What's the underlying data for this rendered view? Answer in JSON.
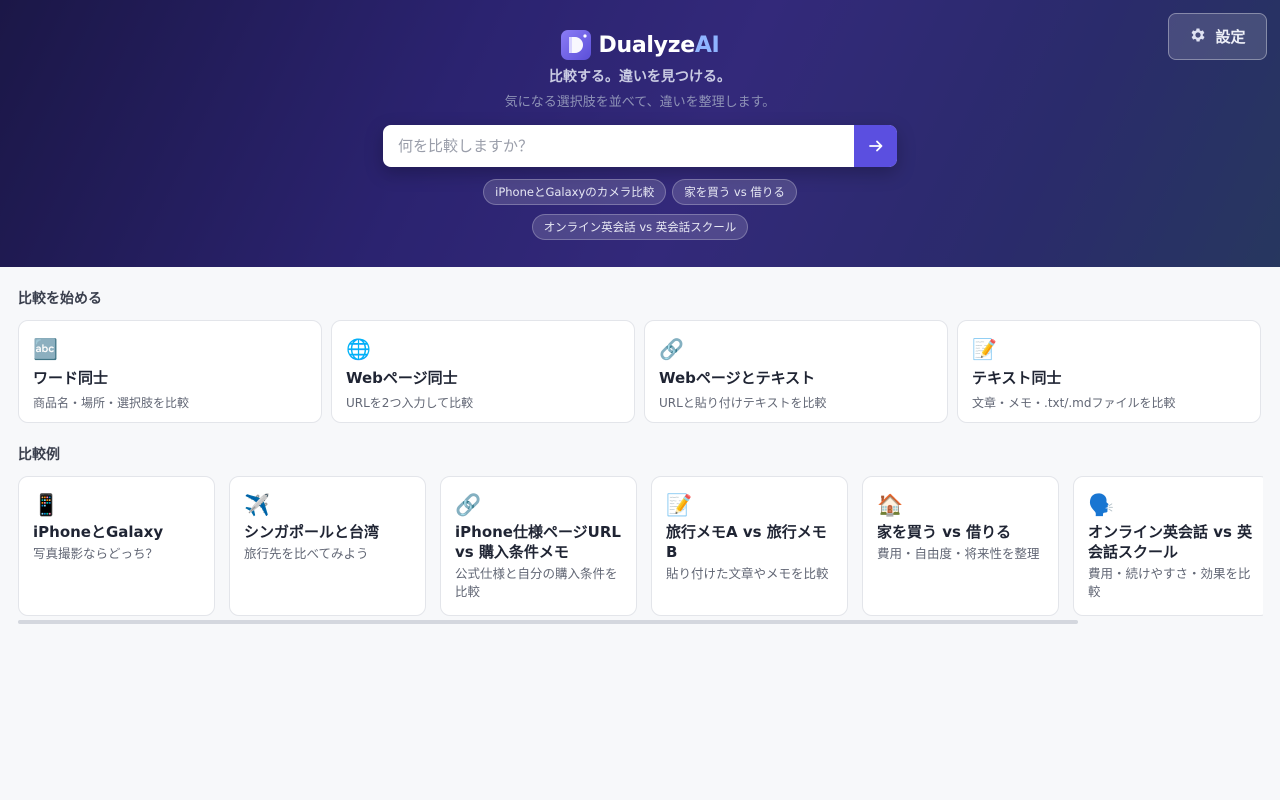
{
  "header": {
    "brand_main": "Dualyze",
    "brand_accent": "AI",
    "tagline": "比較する。違いを見つける。",
    "subtagline": "気になる選択肢を並べて、違いを整理します。",
    "settings_label": "設定"
  },
  "search": {
    "placeholder": "何を比較しますか？",
    "value": ""
  },
  "chips": [
    {
      "label": "iPhoneとGalaxyのカメラ比較"
    },
    {
      "label": "家を買う vs 借りる"
    },
    {
      "label": "オンライン英会話 vs 英会話スクール"
    }
  ],
  "start_section": {
    "title": "比較を始める",
    "cards": [
      {
        "icon": "🔤",
        "title": "ワード同士",
        "desc": "商品名・場所・選択肢を比較"
      },
      {
        "icon": "🌐",
        "title": "Webページ同士",
        "desc": "URLを2つ入力して比較"
      },
      {
        "icon": "🔗",
        "title": "Webページとテキスト",
        "desc": "URLと貼り付けテキストを比較"
      },
      {
        "icon": "📝",
        "title": "テキスト同士",
        "desc": "文章・メモ・.txt/.mdファイルを比較"
      }
    ]
  },
  "examples_section": {
    "title": "比較例",
    "cards": [
      {
        "icon": "📱",
        "title": "iPhoneとGalaxy",
        "desc": "写真撮影ならどっち？"
      },
      {
        "icon": "✈️",
        "title": "シンガポールと台湾",
        "desc": "旅行先を比べてみよう"
      },
      {
        "icon": "🔗",
        "title": "iPhone仕様ページURL vs 購入条件メモ",
        "desc": "公式仕様と自分の購入条件を比較"
      },
      {
        "icon": "📝",
        "title": "旅行メモA vs 旅行メモB",
        "desc": "貼り付けた文章やメモを比較"
      },
      {
        "icon": "🏠",
        "title": "家を買う vs 借りる",
        "desc": "費用・自由度・将来性を整理"
      },
      {
        "icon": "🗣️",
        "title": "オンライン英会話 vs 英会話スクール",
        "desc": "費用・続けやすさ・効果を比較"
      }
    ]
  },
  "colors": {
    "accent": "#5b4fe0",
    "brand_accent": "#8fb4ff"
  }
}
